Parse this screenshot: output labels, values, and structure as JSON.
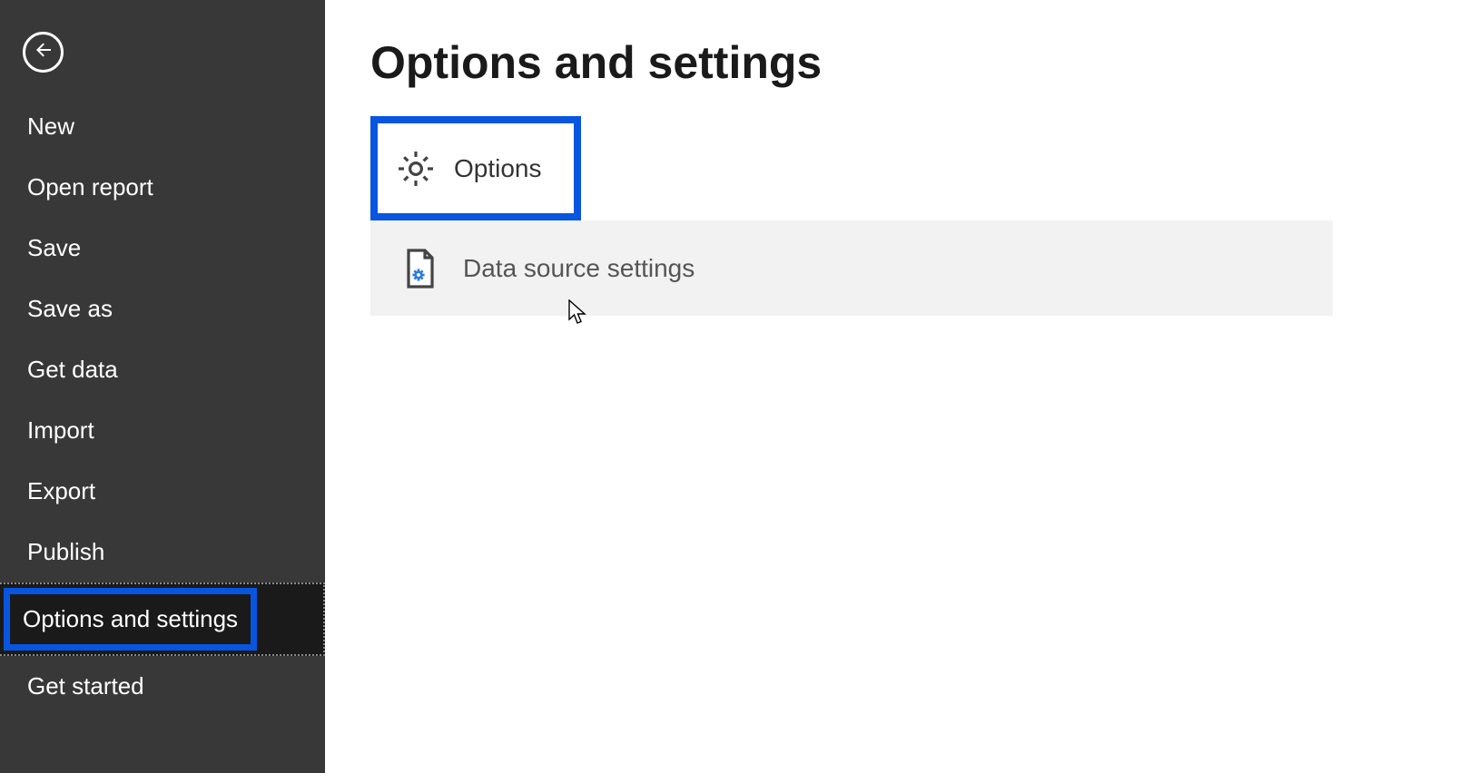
{
  "sidebar": {
    "items": [
      {
        "label": "New"
      },
      {
        "label": "Open report"
      },
      {
        "label": "Save"
      },
      {
        "label": "Save as"
      },
      {
        "label": "Get data"
      },
      {
        "label": "Import"
      },
      {
        "label": "Export"
      },
      {
        "label": "Publish"
      },
      {
        "label": "Options and settings"
      },
      {
        "label": "Get started"
      }
    ]
  },
  "main": {
    "title": "Options and settings",
    "rows": [
      {
        "label": "Options"
      },
      {
        "label": "Data source settings"
      }
    ]
  },
  "colors": {
    "highlight": "#0855e0",
    "sidebar_bg": "#383838"
  }
}
